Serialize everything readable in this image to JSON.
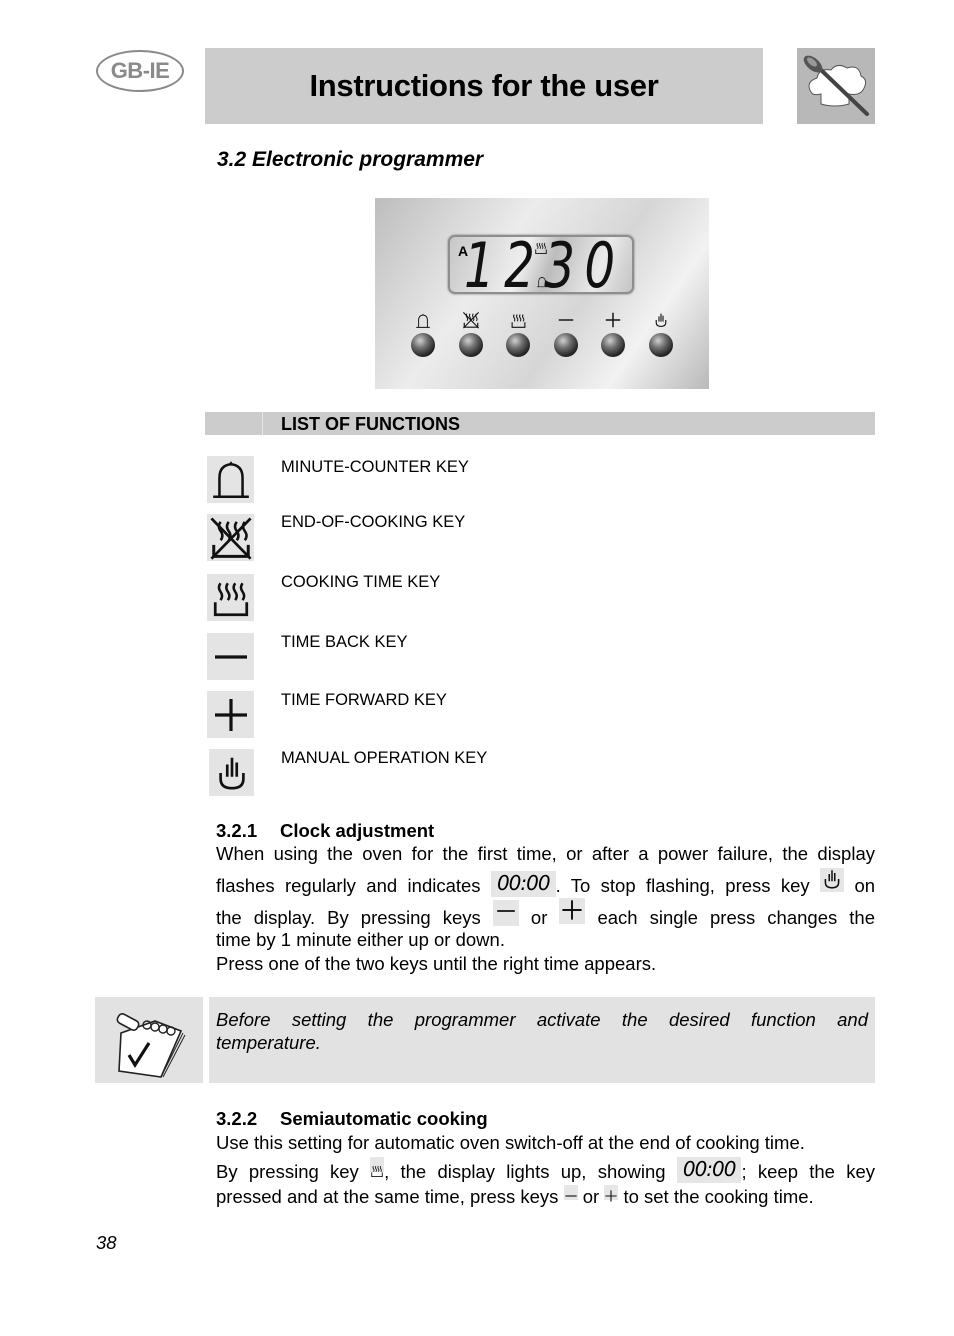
{
  "header": {
    "lang_badge": "GB-IE",
    "title": "Instructions for the user",
    "logo_icon": "chef-hat-spoon-icon"
  },
  "section": {
    "title": "3.2 Electronic programmer"
  },
  "programmer_panel": {
    "display": {
      "auto_indicator": "A",
      "time": "1230",
      "time_readable": "12:30",
      "indicators": [
        "cooking-time-icon",
        "bell-icon"
      ]
    },
    "keys": [
      {
        "icon": "bell-icon"
      },
      {
        "icon": "end-of-cooking-icon"
      },
      {
        "icon": "cooking-time-icon"
      },
      {
        "icon": "minus-icon"
      },
      {
        "icon": "plus-icon"
      },
      {
        "icon": "hand-icon"
      }
    ]
  },
  "functions": {
    "heading": "LIST OF FUNCTIONS",
    "items": [
      {
        "icon": "bell-icon",
        "label": "MINUTE-COUNTER KEY"
      },
      {
        "icon": "end-of-cooking-icon",
        "label": "END-OF-COOKING KEY"
      },
      {
        "icon": "cooking-time-icon",
        "label": "COOKING TIME KEY"
      },
      {
        "icon": "minus-icon",
        "label": "TIME BACK KEY"
      },
      {
        "icon": "plus-icon",
        "label": "TIME FORWARD KEY"
      },
      {
        "icon": "hand-icon",
        "label": "MANUAL OPERATION KEY"
      }
    ]
  },
  "clock_adjustment": {
    "number": "3.2.1",
    "title": "Clock adjustment",
    "line1": "When using the oven for the first time, or after a power failure, the display",
    "line2_a": "flashes regularly and indicates",
    "display_value": "00:00",
    "line2_b": ". To stop flashing, press key",
    "line2_c": "on",
    "line3_a": "the display. By pressing keys",
    "line3_b": "or",
    "line3_c": "each single press changes the",
    "line4": "time by 1 minute either up or down.",
    "line5": "Press one of the two keys until the right time appears."
  },
  "note": {
    "icon": "notepad-check-icon",
    "line1": "Before setting the programmer activate the desired function and",
    "line2": "temperature."
  },
  "semiautomatic": {
    "number": "3.2.2",
    "title": "Semiautomatic cooking",
    "line1": "Use this setting for automatic oven switch-off at the end of cooking time.",
    "line2_a": "By pressing key",
    "line2_b": ", the display lights up, showing",
    "display_value": "00:00",
    "line2_c": "; keep the key",
    "line3_a": "pressed and at the same time, press keys",
    "line3_b": "or",
    "line3_c": "to set the cooking time."
  },
  "footer": {
    "page_number": "38"
  }
}
